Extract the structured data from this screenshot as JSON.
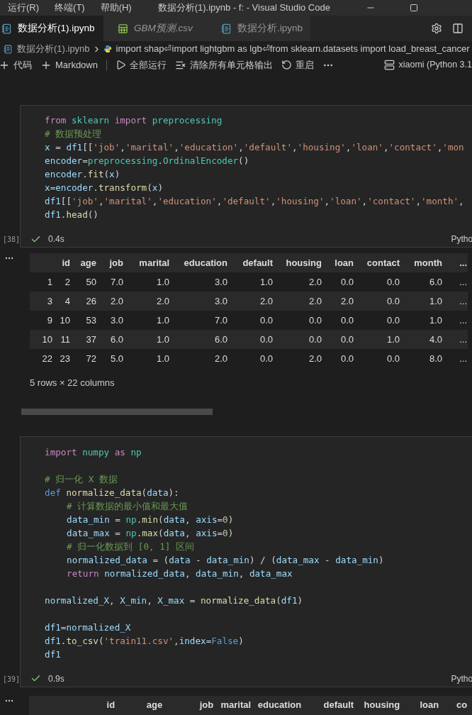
{
  "title_bar": {
    "menus": [
      "运行(R)",
      "终端(T)",
      "帮助(H)"
    ],
    "title": "数据分析(1).ipynb - f: - Visual Studio Code"
  },
  "tabs": [
    {
      "label": "数据分析(1).ipynb",
      "kind": "notebook",
      "selected": true,
      "preview": false
    },
    {
      "label": "GBM预测.csv",
      "kind": "csv",
      "selected": false,
      "preview": true
    },
    {
      "label": "数据分析.ipynb",
      "kind": "notebook",
      "selected": false,
      "preview": false
    }
  ],
  "breadcrumb": {
    "file": "数据分析(1).ipynb",
    "symbol": "import shap⏎import lightgbm as lgb⏎from sklearn.datasets import load_breast_cancer"
  },
  "toolbar": {
    "items": [
      {
        "kind": "plus",
        "label": "代码"
      },
      {
        "kind": "plus",
        "label": "Markdown"
      },
      {
        "kind": "separator"
      },
      {
        "kind": "run",
        "label": "全部运行"
      },
      {
        "kind": "clear",
        "label": "清除所有单元格输出"
      },
      {
        "kind": "restart",
        "label": "重启"
      },
      {
        "kind": "more"
      }
    ],
    "kernel": "xiaomi (Python 3.1"
  },
  "cells": [
    {
      "count": "[38]",
      "time": "0.4s",
      "language": "Pytho",
      "succeeded": true,
      "lines": [
        {
          "gap_before": false,
          "indented": false,
          "tokens": [
            {
              "kind": "kw",
              "text": "from "
            },
            {
              "kind": "mod",
              "text": "sklearn "
            },
            {
              "kind": "kw",
              "text": "import "
            },
            {
              "kind": "mod",
              "text": "preprocessing"
            }
          ]
        },
        {
          "gap_before": false,
          "indented": false,
          "tokens": [
            {
              "kind": "com",
              "text": "# 数据预处理"
            }
          ]
        },
        {
          "gap_before": false,
          "indented": false,
          "tokens": [
            {
              "kind": "var",
              "text": "x"
            },
            {
              "kind": "p",
              "text": " = "
            },
            {
              "kind": "var",
              "text": "df1"
            },
            {
              "kind": "p",
              "text": "[["
            },
            {
              "kind": "str",
              "text": "'job'"
            },
            {
              "kind": "p",
              "text": ","
            },
            {
              "kind": "str",
              "text": "'marital'"
            },
            {
              "kind": "p",
              "text": ","
            },
            {
              "kind": "str",
              "text": "'education'"
            },
            {
              "kind": "p",
              "text": ","
            },
            {
              "kind": "str",
              "text": "'default'"
            },
            {
              "kind": "p",
              "text": ","
            },
            {
              "kind": "str",
              "text": "'housing'"
            },
            {
              "kind": "p",
              "text": ","
            },
            {
              "kind": "str",
              "text": "'loan'"
            },
            {
              "kind": "p",
              "text": ","
            },
            {
              "kind": "str",
              "text": "'contact'"
            },
            {
              "kind": "p",
              "text": ","
            },
            {
              "kind": "str",
              "text": "'mon"
            }
          ]
        },
        {
          "gap_before": false,
          "indented": false,
          "tokens": [
            {
              "kind": "var",
              "text": "encoder"
            },
            {
              "kind": "p",
              "text": "="
            },
            {
              "kind": "mod",
              "text": "preprocessing"
            },
            {
              "kind": "p",
              "text": "."
            },
            {
              "kind": "mod",
              "text": "OrdinalEncoder"
            },
            {
              "kind": "p",
              "text": "()"
            }
          ]
        },
        {
          "gap_before": false,
          "indented": false,
          "tokens": [
            {
              "kind": "var",
              "text": "encoder"
            },
            {
              "kind": "p",
              "text": "."
            },
            {
              "kind": "fn",
              "text": "fit"
            },
            {
              "kind": "p",
              "text": "("
            },
            {
              "kind": "var",
              "text": "x"
            },
            {
              "kind": "p",
              "text": ")"
            }
          ]
        },
        {
          "gap_before": false,
          "indented": false,
          "tokens": [
            {
              "kind": "var",
              "text": "x"
            },
            {
              "kind": "p",
              "text": "="
            },
            {
              "kind": "var",
              "text": "encoder"
            },
            {
              "kind": "p",
              "text": "."
            },
            {
              "kind": "fn",
              "text": "transform"
            },
            {
              "kind": "p",
              "text": "("
            },
            {
              "kind": "var",
              "text": "x"
            },
            {
              "kind": "p",
              "text": ")"
            }
          ]
        },
        {
          "gap_before": false,
          "indented": false,
          "tokens": [
            {
              "kind": "var",
              "text": "df1"
            },
            {
              "kind": "p",
              "text": "[["
            },
            {
              "kind": "str",
              "text": "'job'"
            },
            {
              "kind": "p",
              "text": ","
            },
            {
              "kind": "str",
              "text": "'marital'"
            },
            {
              "kind": "p",
              "text": ","
            },
            {
              "kind": "str",
              "text": "'education'"
            },
            {
              "kind": "p",
              "text": ","
            },
            {
              "kind": "str",
              "text": "'default'"
            },
            {
              "kind": "p",
              "text": ","
            },
            {
              "kind": "str",
              "text": "'housing'"
            },
            {
              "kind": "p",
              "text": ","
            },
            {
              "kind": "str",
              "text": "'loan'"
            },
            {
              "kind": "p",
              "text": ","
            },
            {
              "kind": "str",
              "text": "'contact'"
            },
            {
              "kind": "p",
              "text": ","
            },
            {
              "kind": "str",
              "text": "'month'"
            },
            {
              "kind": "p",
              "text": ","
            }
          ]
        },
        {
          "gap_before": false,
          "indented": false,
          "tokens": [
            {
              "kind": "var",
              "text": "df1."
            },
            {
              "kind": "fn",
              "text": "head"
            },
            {
              "kind": "p",
              "text": "()"
            }
          ]
        }
      ],
      "output": {
        "columns": [
          "id",
          "age",
          "job",
          "marital",
          "education",
          "default",
          "housing",
          "loan",
          "contact",
          "month",
          "..."
        ],
        "rows": [
          {
            "index": "1",
            "cells": [
              "2",
              "50",
              "7.0",
              "1.0",
              "3.0",
              "1.0",
              "2.0",
              "0.0",
              "0.0",
              "6.0",
              "..."
            ]
          },
          {
            "index": "3",
            "cells": [
              "4",
              "26",
              "2.0",
              "2.0",
              "3.0",
              "2.0",
              "2.0",
              "2.0",
              "0.0",
              "1.0",
              "..."
            ]
          },
          {
            "index": "9",
            "cells": [
              "10",
              "53",
              "3.0",
              "1.0",
              "7.0",
              "0.0",
              "0.0",
              "0.0",
              "0.0",
              "1.0",
              "..."
            ]
          },
          {
            "index": "10",
            "cells": [
              "11",
              "37",
              "6.0",
              "1.0",
              "6.0",
              "0.0",
              "0.0",
              "0.0",
              "1.0",
              "4.0",
              "..."
            ]
          },
          {
            "index": "22",
            "cells": [
              "23",
              "72",
              "5.0",
              "1.0",
              "2.0",
              "0.0",
              "2.0",
              "0.0",
              "0.0",
              "8.0",
              "..."
            ]
          }
        ],
        "summary": "5 rows × 22 columns"
      }
    },
    {
      "count": "[39]",
      "time": "0.9s",
      "language": "Pytho",
      "succeeded": true,
      "lines": [
        {
          "gap_before": false,
          "indented": false,
          "tokens": [
            {
              "kind": "kw",
              "text": "import "
            },
            {
              "kind": "mod",
              "text": "numpy "
            },
            {
              "kind": "kw",
              "text": "as "
            },
            {
              "kind": "mod",
              "text": "np"
            }
          ]
        },
        {
          "gap_before": true,
          "indented": false,
          "tokens": [
            {
              "kind": "com",
              "text": "# 归一化 X 数据"
            }
          ]
        },
        {
          "gap_before": false,
          "indented": false,
          "tokens": [
            {
              "kind": "def",
              "text": "def "
            },
            {
              "kind": "fn",
              "text": "normalize_data"
            },
            {
              "kind": "p",
              "text": "("
            },
            {
              "kind": "var",
              "text": "data"
            },
            {
              "kind": "p",
              "text": "):"
            }
          ]
        },
        {
          "gap_before": false,
          "indented": true,
          "tokens": [
            {
              "kind": "com",
              "text": "# 计算数据的最小值和最大值"
            }
          ]
        },
        {
          "gap_before": false,
          "indented": true,
          "tokens": [
            {
              "kind": "var",
              "text": "data_min"
            },
            {
              "kind": "p",
              "text": " = "
            },
            {
              "kind": "mod",
              "text": "np"
            },
            {
              "kind": "p",
              "text": "."
            },
            {
              "kind": "fn",
              "text": "min"
            },
            {
              "kind": "p",
              "text": "("
            },
            {
              "kind": "var",
              "text": "data"
            },
            {
              "kind": "p",
              "text": ", "
            },
            {
              "kind": "var",
              "text": "axis"
            },
            {
              "kind": "p",
              "text": "="
            },
            {
              "kind": "num",
              "text": "0"
            },
            {
              "kind": "p",
              "text": ")"
            }
          ]
        },
        {
          "gap_before": false,
          "indented": true,
          "tokens": [
            {
              "kind": "var",
              "text": "data_max"
            },
            {
              "kind": "p",
              "text": " = "
            },
            {
              "kind": "mod",
              "text": "np"
            },
            {
              "kind": "p",
              "text": "."
            },
            {
              "kind": "fn",
              "text": "max"
            },
            {
              "kind": "p",
              "text": "("
            },
            {
              "kind": "var",
              "text": "data"
            },
            {
              "kind": "p",
              "text": ", "
            },
            {
              "kind": "var",
              "text": "axis"
            },
            {
              "kind": "p",
              "text": "="
            },
            {
              "kind": "num",
              "text": "0"
            },
            {
              "kind": "p",
              "text": ")"
            }
          ]
        },
        {
          "gap_before": false,
          "indented": true,
          "tokens": [
            {
              "kind": "com",
              "text": "# 归一化数据到 [0, 1] 区间"
            }
          ]
        },
        {
          "gap_before": false,
          "indented": true,
          "tokens": [
            {
              "kind": "var",
              "text": "normalized_data"
            },
            {
              "kind": "p",
              "text": " = ("
            },
            {
              "kind": "var",
              "text": "data"
            },
            {
              "kind": "p",
              "text": " - "
            },
            {
              "kind": "var",
              "text": "data_min"
            },
            {
              "kind": "p",
              "text": ") / ("
            },
            {
              "kind": "var",
              "text": "data_max"
            },
            {
              "kind": "p",
              "text": " - "
            },
            {
              "kind": "var",
              "text": "data_min"
            },
            {
              "kind": "p",
              "text": ")"
            }
          ]
        },
        {
          "gap_before": false,
          "indented": true,
          "tokens": [
            {
              "kind": "kw",
              "text": "return "
            },
            {
              "kind": "var",
              "text": "normalized_data"
            },
            {
              "kind": "p",
              "text": ", "
            },
            {
              "kind": "var",
              "text": "data_min"
            },
            {
              "kind": "p",
              "text": ", "
            },
            {
              "kind": "var",
              "text": "data_max"
            }
          ]
        },
        {
          "gap_before": true,
          "indented": false,
          "tokens": [
            {
              "kind": "var",
              "text": "normalized_X"
            },
            {
              "kind": "p",
              "text": ", "
            },
            {
              "kind": "var",
              "text": "X_min"
            },
            {
              "kind": "p",
              "text": ", "
            },
            {
              "kind": "var",
              "text": "X_max"
            },
            {
              "kind": "p",
              "text": " = "
            },
            {
              "kind": "fn",
              "text": "normalize_data"
            },
            {
              "kind": "p",
              "text": "("
            },
            {
              "kind": "var",
              "text": "df1"
            },
            {
              "kind": "p",
              "text": ")"
            }
          ]
        },
        {
          "gap_before": true,
          "indented": false,
          "tokens": [
            {
              "kind": "var",
              "text": "df1"
            },
            {
              "kind": "p",
              "text": "="
            },
            {
              "kind": "var",
              "text": "normalized_X"
            }
          ]
        },
        {
          "gap_before": false,
          "indented": false,
          "tokens": [
            {
              "kind": "var",
              "text": "df1"
            },
            {
              "kind": "p",
              "text": "."
            },
            {
              "kind": "fn",
              "text": "to_csv"
            },
            {
              "kind": "p",
              "text": "("
            },
            {
              "kind": "str",
              "text": "'train11.csv'"
            },
            {
              "kind": "p",
              "text": ","
            },
            {
              "kind": "var",
              "text": "index"
            },
            {
              "kind": "p",
              "text": "="
            },
            {
              "kind": "def",
              "text": "False"
            },
            {
              "kind": "p",
              "text": ")"
            }
          ]
        },
        {
          "gap_before": false,
          "indented": false,
          "tokens": [
            {
              "kind": "var",
              "text": "df1"
            }
          ]
        }
      ],
      "output": {
        "columns": [
          "id",
          "age",
          "job",
          "marital",
          "education",
          "default",
          "housing",
          "loan",
          "co"
        ]
      }
    }
  ]
}
